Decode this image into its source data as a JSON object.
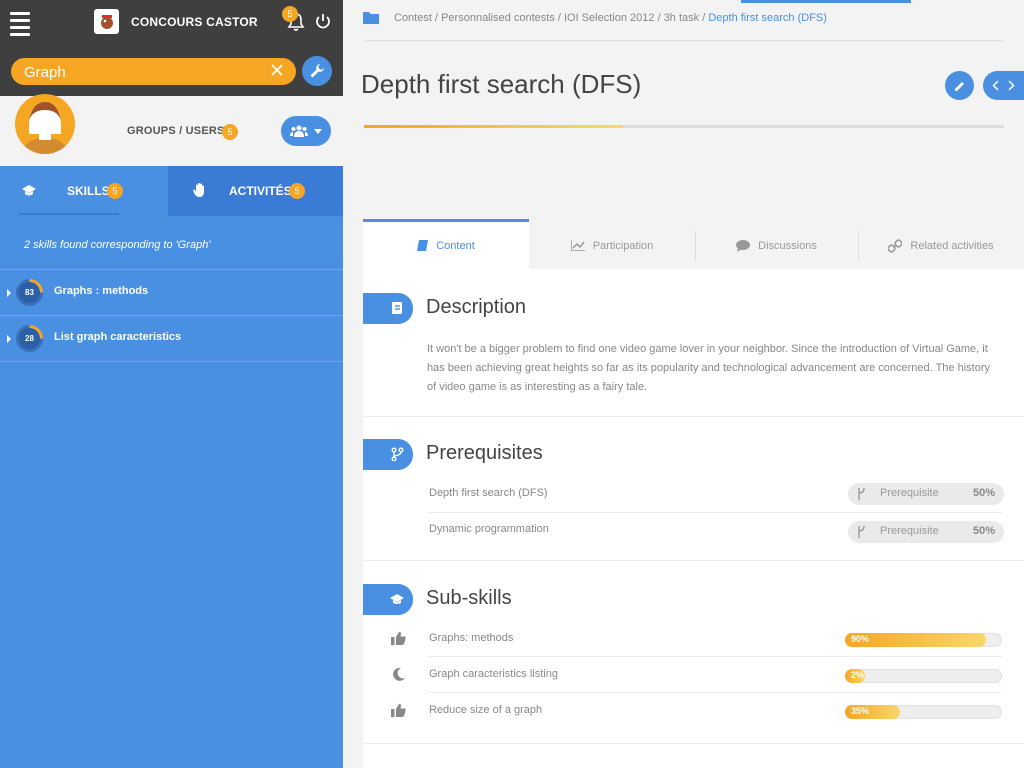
{
  "app": {
    "brand": "CONCOURS CASTOR",
    "notifications": "5"
  },
  "search": {
    "value": "Graph",
    "placeholder": ""
  },
  "profile": {
    "groups_label": "GROUPS / USERS",
    "groups_count": "5"
  },
  "tabs": {
    "skills": {
      "label": "SKILLS",
      "count": "5"
    },
    "activities": {
      "label": "ACTIVITÉS",
      "count": "5"
    }
  },
  "results": {
    "summary": "2 skills found corresponding to  'Graph'",
    "items": [
      {
        "score": "83",
        "label": "Graphs : methods"
      },
      {
        "score": "28",
        "label": "List graph caracteristics"
      }
    ]
  },
  "breadcrumb": {
    "parts": [
      "Contest",
      "Personnalised contests",
      "IOI Selection 2012",
      "3h task"
    ],
    "current": "Depth first search (DFS)"
  },
  "page": {
    "title": "Depth first search (DFS)",
    "progress": 0.405
  },
  "content_tabs": [
    "Content",
    "Participation",
    "Discussions",
    "Related activities"
  ],
  "description": {
    "title": "Description",
    "text": "It won't be a bigger problem to find one video game lover in your neighbor. Since the introduction of Virtual Game, it has been achieving great heights so far as its popularity and technological advancement are concerned. The history of video game is as interesting as a fairy tale."
  },
  "prerequisites": {
    "title": "Prerequisites",
    "items": [
      {
        "name": "Depth first search (DFS)",
        "tag": "Prerequisite",
        "value": "50%"
      },
      {
        "name": "Dynamic programmation",
        "tag": "Prerequisite",
        "value": "50%"
      }
    ]
  },
  "subskills": {
    "title": "Sub-skills",
    "items": [
      {
        "name": "Graphs: methods",
        "label": "90%",
        "value": 0.9,
        "icon": "thumbs-up-icon"
      },
      {
        "name": "Graph caracteristics listing",
        "label": "2%",
        "value": 0.02,
        "icon": "moon-icon"
      },
      {
        "name": "Reduce size of a graph",
        "label": "35%",
        "value": 0.35,
        "icon": "thumbs-up-icon"
      }
    ]
  },
  "colors": {
    "accent": "#4a90e2",
    "orange": "#f5a623",
    "dark": "#3f3f3f"
  }
}
